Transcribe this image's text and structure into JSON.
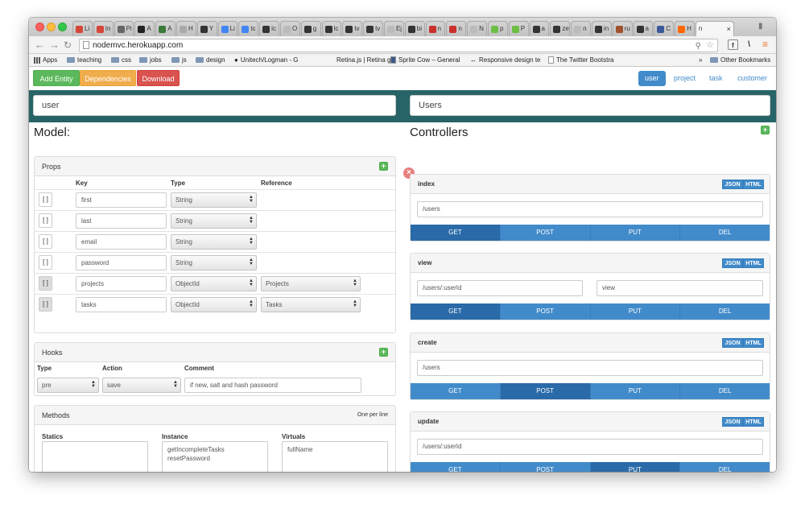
{
  "browser": {
    "tabs": [
      {
        "label": "Li",
        "color": "#d44638"
      },
      {
        "label": "In",
        "color": "#d44638"
      },
      {
        "label": "Pi",
        "color": "#666666"
      },
      {
        "label": "A",
        "color": "#222222"
      },
      {
        "label": "A",
        "color": "#3b7a3b"
      },
      {
        "label": "H",
        "color": "#aaaaaa"
      },
      {
        "label": "Y",
        "color": "#333333"
      },
      {
        "label": "Li",
        "color": "#4285f4"
      },
      {
        "label": "tc",
        "color": "#4285f4"
      },
      {
        "label": "lc",
        "color": "#333333"
      },
      {
        "label": "O",
        "color": "#bbbbbb"
      },
      {
        "label": "g",
        "color": "#333333"
      },
      {
        "label": "lc",
        "color": "#333333"
      },
      {
        "label": "tv",
        "color": "#333333"
      },
      {
        "label": "tv",
        "color": "#333333"
      },
      {
        "label": "Ej",
        "color": "#bbbbbb"
      },
      {
        "label": "bi",
        "color": "#333333"
      },
      {
        "label": "n",
        "color": "#c9302c"
      },
      {
        "label": "n",
        "color": "#c9302c"
      },
      {
        "label": "N",
        "color": "#bbbbbb"
      },
      {
        "label": "p",
        "color": "#6cbe45"
      },
      {
        "label": "P",
        "color": "#6cbe45"
      },
      {
        "label": "a",
        "color": "#333333"
      },
      {
        "label": "ze",
        "color": "#333333"
      },
      {
        "label": "n",
        "color": "#bbbbbb"
      },
      {
        "label": "in",
        "color": "#333333"
      },
      {
        "label": "ru",
        "color": "#a0522d"
      },
      {
        "label": "a",
        "color": "#333333"
      },
      {
        "label": "C",
        "color": "#3b5998"
      },
      {
        "label": "H",
        "color": "#ff6600"
      }
    ],
    "active_tab": "n",
    "active_tab_close": "×",
    "url": "nodemvc.herokuapp.com",
    "bookmarks": {
      "apps": "Apps",
      "teaching": "teaching",
      "css": "css",
      "jobs": "jobs",
      "js": "js",
      "design": "design",
      "unitech": "Unitech/Logman - G",
      "retina": "Retina.js | Retina gra",
      "sprite": "Sprite Cow – General",
      "responsive": "Responsive design te",
      "bootstrap": "The Twitter Bootstra",
      "more": "»",
      "other": "Other Bookmarks"
    }
  },
  "nav": {
    "add_entity": "Add Entity",
    "dependencies": "Dependencies",
    "download": "Download",
    "pills": [
      "user",
      "project",
      "task",
      "customer"
    ],
    "active_pill": "user"
  },
  "header_inputs": {
    "model_name": "user",
    "controller_name": "Users"
  },
  "model": {
    "title": "Model:",
    "props": {
      "title": "Props",
      "columns": [
        "Key",
        "Type",
        "Reference"
      ],
      "rows": [
        {
          "arr": "[ ]",
          "key": "first",
          "type": "String",
          "reference": ""
        },
        {
          "arr": "[ ]",
          "key": "last",
          "type": "String",
          "reference": ""
        },
        {
          "arr": "[ ]",
          "key": "email",
          "type": "String",
          "reference": ""
        },
        {
          "arr": "[ ]",
          "key": "password",
          "type": "String",
          "reference": ""
        },
        {
          "arr": "[ ]",
          "key": "projects",
          "type": "ObjectId",
          "reference": "Projects"
        },
        {
          "arr": "[ ]",
          "key": "tasks",
          "type": "ObjectId",
          "reference": "Tasks"
        }
      ]
    },
    "hooks": {
      "title": "Hooks",
      "columns": [
        "Type",
        "Action",
        "Comment"
      ],
      "type": "pre",
      "action": "save",
      "comment": "if new, salt and hash password"
    },
    "methods": {
      "title": "Methods",
      "note": "One per line",
      "statics_label": "Statics",
      "instance_label": "Instance",
      "virtuals_label": "Virtuals",
      "statics": "",
      "instance": [
        "getIncompleteTasks",
        "resetPassword"
      ],
      "virtuals": [
        "fullName"
      ]
    }
  },
  "controllers": {
    "title": "Controllers",
    "format_json": "JSON",
    "format_html": "HTML",
    "methods": [
      "GET",
      "POST",
      "PUT",
      "DEL"
    ],
    "items": [
      {
        "name": "index",
        "route": "/users",
        "view": "",
        "active": "GET"
      },
      {
        "name": "view",
        "route": "/users/:userId",
        "view": "view",
        "active": "GET"
      },
      {
        "name": "create",
        "route": "/users",
        "view": "",
        "active": "POST"
      },
      {
        "name": "update",
        "route": "/users/:userId",
        "view": "",
        "active": "PUT"
      }
    ]
  }
}
